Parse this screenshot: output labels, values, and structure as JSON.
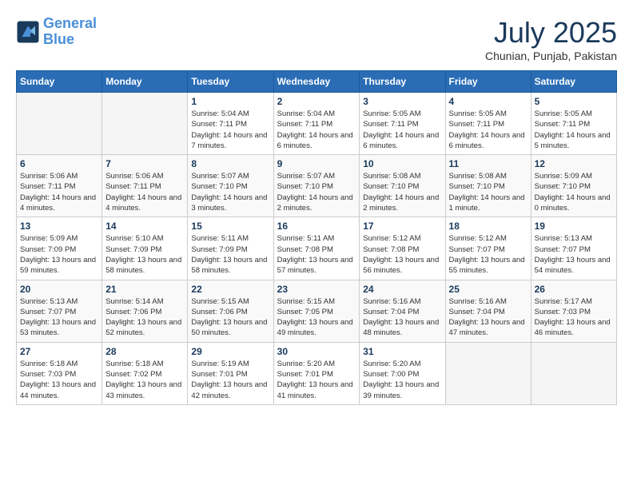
{
  "header": {
    "logo_line1": "General",
    "logo_line2": "Blue",
    "month_title": "July 2025",
    "location": "Chunian, Punjab, Pakistan"
  },
  "weekdays": [
    "Sunday",
    "Monday",
    "Tuesday",
    "Wednesday",
    "Thursday",
    "Friday",
    "Saturday"
  ],
  "weeks": [
    [
      {
        "day": "",
        "info": ""
      },
      {
        "day": "",
        "info": ""
      },
      {
        "day": "1",
        "info": "Sunrise: 5:04 AM\nSunset: 7:11 PM\nDaylight: 14 hours and 7 minutes."
      },
      {
        "day": "2",
        "info": "Sunrise: 5:04 AM\nSunset: 7:11 PM\nDaylight: 14 hours and 6 minutes."
      },
      {
        "day": "3",
        "info": "Sunrise: 5:05 AM\nSunset: 7:11 PM\nDaylight: 14 hours and 6 minutes."
      },
      {
        "day": "4",
        "info": "Sunrise: 5:05 AM\nSunset: 7:11 PM\nDaylight: 14 hours and 6 minutes."
      },
      {
        "day": "5",
        "info": "Sunrise: 5:05 AM\nSunset: 7:11 PM\nDaylight: 14 hours and 5 minutes."
      }
    ],
    [
      {
        "day": "6",
        "info": "Sunrise: 5:06 AM\nSunset: 7:11 PM\nDaylight: 14 hours and 4 minutes."
      },
      {
        "day": "7",
        "info": "Sunrise: 5:06 AM\nSunset: 7:11 PM\nDaylight: 14 hours and 4 minutes."
      },
      {
        "day": "8",
        "info": "Sunrise: 5:07 AM\nSunset: 7:10 PM\nDaylight: 14 hours and 3 minutes."
      },
      {
        "day": "9",
        "info": "Sunrise: 5:07 AM\nSunset: 7:10 PM\nDaylight: 14 hours and 2 minutes."
      },
      {
        "day": "10",
        "info": "Sunrise: 5:08 AM\nSunset: 7:10 PM\nDaylight: 14 hours and 2 minutes."
      },
      {
        "day": "11",
        "info": "Sunrise: 5:08 AM\nSunset: 7:10 PM\nDaylight: 14 hours and 1 minute."
      },
      {
        "day": "12",
        "info": "Sunrise: 5:09 AM\nSunset: 7:10 PM\nDaylight: 14 hours and 0 minutes."
      }
    ],
    [
      {
        "day": "13",
        "info": "Sunrise: 5:09 AM\nSunset: 7:09 PM\nDaylight: 13 hours and 59 minutes."
      },
      {
        "day": "14",
        "info": "Sunrise: 5:10 AM\nSunset: 7:09 PM\nDaylight: 13 hours and 58 minutes."
      },
      {
        "day": "15",
        "info": "Sunrise: 5:11 AM\nSunset: 7:09 PM\nDaylight: 13 hours and 58 minutes."
      },
      {
        "day": "16",
        "info": "Sunrise: 5:11 AM\nSunset: 7:08 PM\nDaylight: 13 hours and 57 minutes."
      },
      {
        "day": "17",
        "info": "Sunrise: 5:12 AM\nSunset: 7:08 PM\nDaylight: 13 hours and 56 minutes."
      },
      {
        "day": "18",
        "info": "Sunrise: 5:12 AM\nSunset: 7:07 PM\nDaylight: 13 hours and 55 minutes."
      },
      {
        "day": "19",
        "info": "Sunrise: 5:13 AM\nSunset: 7:07 PM\nDaylight: 13 hours and 54 minutes."
      }
    ],
    [
      {
        "day": "20",
        "info": "Sunrise: 5:13 AM\nSunset: 7:07 PM\nDaylight: 13 hours and 53 minutes."
      },
      {
        "day": "21",
        "info": "Sunrise: 5:14 AM\nSunset: 7:06 PM\nDaylight: 13 hours and 52 minutes."
      },
      {
        "day": "22",
        "info": "Sunrise: 5:15 AM\nSunset: 7:06 PM\nDaylight: 13 hours and 50 minutes."
      },
      {
        "day": "23",
        "info": "Sunrise: 5:15 AM\nSunset: 7:05 PM\nDaylight: 13 hours and 49 minutes."
      },
      {
        "day": "24",
        "info": "Sunrise: 5:16 AM\nSunset: 7:04 PM\nDaylight: 13 hours and 48 minutes."
      },
      {
        "day": "25",
        "info": "Sunrise: 5:16 AM\nSunset: 7:04 PM\nDaylight: 13 hours and 47 minutes."
      },
      {
        "day": "26",
        "info": "Sunrise: 5:17 AM\nSunset: 7:03 PM\nDaylight: 13 hours and 46 minutes."
      }
    ],
    [
      {
        "day": "27",
        "info": "Sunrise: 5:18 AM\nSunset: 7:03 PM\nDaylight: 13 hours and 44 minutes."
      },
      {
        "day": "28",
        "info": "Sunrise: 5:18 AM\nSunset: 7:02 PM\nDaylight: 13 hours and 43 minutes."
      },
      {
        "day": "29",
        "info": "Sunrise: 5:19 AM\nSunset: 7:01 PM\nDaylight: 13 hours and 42 minutes."
      },
      {
        "day": "30",
        "info": "Sunrise: 5:20 AM\nSunset: 7:01 PM\nDaylight: 13 hours and 41 minutes."
      },
      {
        "day": "31",
        "info": "Sunrise: 5:20 AM\nSunset: 7:00 PM\nDaylight: 13 hours and 39 minutes."
      },
      {
        "day": "",
        "info": ""
      },
      {
        "day": "",
        "info": ""
      }
    ]
  ]
}
